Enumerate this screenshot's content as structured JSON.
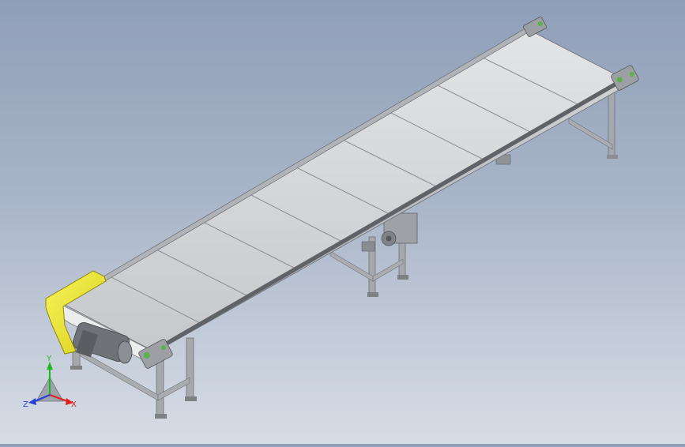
{
  "viewport": {
    "background_top": "#8f9fb8",
    "background_bottom": "#d7dde6"
  },
  "model": {
    "belt_panels": 10,
    "frame_color": "#b9bcc0",
    "belt_color": "#d4d6d8",
    "guard_color": "#f2ef2c",
    "accent_color": "#5db14a"
  },
  "triad": {
    "x_label": "X",
    "y_label": "Y",
    "z_label": "Z",
    "x_color": "#e02020",
    "y_color": "#1fb81f",
    "z_color": "#2a3fd8"
  }
}
